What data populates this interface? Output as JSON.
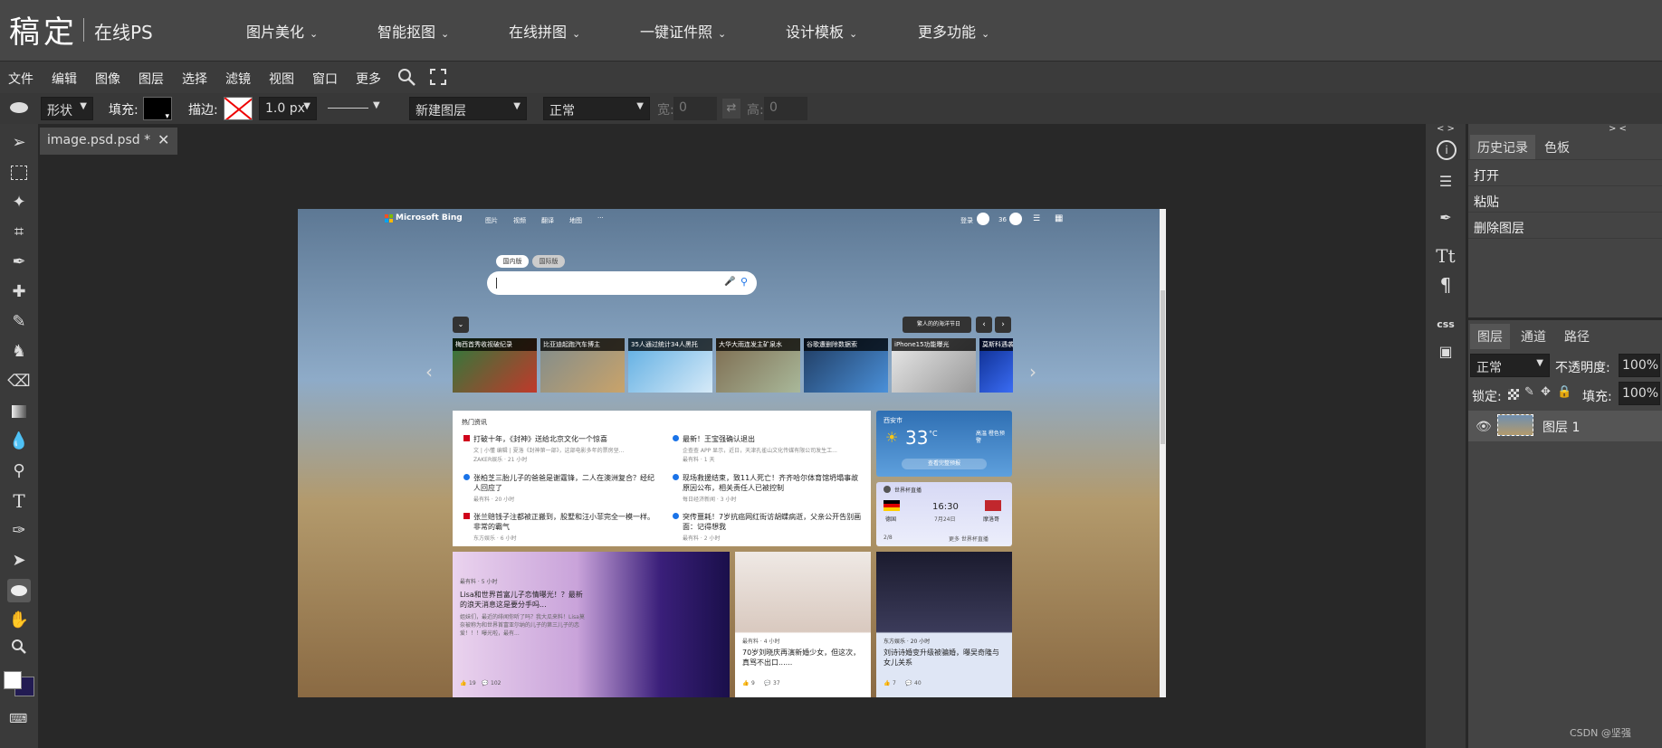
{
  "app": {
    "logo": "稿定",
    "logo_sub": "在线PS"
  },
  "topnav": [
    {
      "label": "图片美化"
    },
    {
      "label": "智能抠图"
    },
    {
      "label": "在线拼图"
    },
    {
      "label": "一键证件照"
    },
    {
      "label": "设计模板"
    },
    {
      "label": "更多功能"
    }
  ],
  "menubar": [
    "文件",
    "编辑",
    "图像",
    "图层",
    "选择",
    "滤镜",
    "视图",
    "窗口",
    "更多"
  ],
  "options": {
    "shape_mode": "形状",
    "fill_label": "填充:",
    "stroke_label": "描边:",
    "stroke_width": "1.0 px",
    "layer_mode": "新建图层",
    "blend_mode": "正常",
    "width_label": "宽:",
    "width_value": "0",
    "height_label": "高:",
    "height_value": "0",
    "fill_color": "#000000"
  },
  "document": {
    "tab_label": "image.psd.psd *"
  },
  "history_panel": {
    "tabs": [
      "历史记录",
      "色板"
    ],
    "items": [
      "打开",
      "粘贴",
      "删除图层"
    ]
  },
  "layers_panel": {
    "tabs": [
      "图层",
      "通道",
      "路径"
    ],
    "blend_mode": "正常",
    "opacity_label": "不透明度:",
    "opacity_value": "100%",
    "lock_label": "锁定:",
    "fill_label": "填充:",
    "fill_value": "100%",
    "layers": [
      {
        "name": "图层 1"
      }
    ]
  },
  "right_strip_collapse": "< >",
  "right_panel_collapse": "> <",
  "watermark": "CSDN @坚强",
  "canvas_page": {
    "brand": "Microsoft Bing",
    "nav": [
      "图片",
      "视频",
      "翻译",
      "地图",
      "···"
    ],
    "login": "登录",
    "points": "36",
    "search_tabs": [
      "国内版",
      "国际版"
    ],
    "location_chip": "繁人的的海洋节日",
    "thumbs": [
      "梅西首秀收视破纪录",
      "比亚迪起跑汽车博主",
      "35人通过统计34人黑托",
      "大华大雨连发主矿泉水",
      "谷歌遭删除数据索",
      "iPhone15功能曝光",
      "莫斯科遇袭"
    ],
    "hot_title": "热门资讯",
    "news": [
      {
        "title": "打破十年，《封神》送给北京文化一个惊喜",
        "snippet": "文 | 小懂 编辑 | 夏洛《封神第一部》，这部电影多年的票房坚...",
        "meta": "ZAKER娱乐 · 21 小时"
      },
      {
        "title": "最新！王宝强确认退出",
        "snippet": "企查查 APP 显示，近日，天津孔雀山文化传媒有限公司发生工...",
        "meta": "最有料 · 1 天"
      },
      {
        "title": "张柏芝三胎儿子的爸爸是谢霆锋，二人在澳洲复合？经纪人回应了",
        "snippet": "",
        "meta": "最有料 · 20 小时"
      },
      {
        "title": "现场救援结束，致11人死亡！齐齐哈尔体育馆坍塌事故原因公布，相关责任人已被控制",
        "snippet": "",
        "meta": "每日经济新闻 · 3 小时"
      },
      {
        "title": "张兰赔钱子注都被正搬到，股墅和汪小菲完全一模一样。非常的霸气",
        "snippet": "",
        "meta": "东方娱乐 · 6 小时"
      },
      {
        "title": "突传噩耗！7岁抗癌网红街访胡蝶病逝，父亲公开告别画面：记得想我",
        "snippet": "",
        "meta": "最有料 · 2 小时"
      }
    ],
    "weather": {
      "city": "西安市",
      "temp": "33",
      "unit": "°C",
      "link": "查看完整预报",
      "note": "高温 橙色预警"
    },
    "match": {
      "title": "世界杯直播",
      "team1": "德国",
      "team2": "摩洛哥",
      "time": "16:30",
      "date": "7月24日",
      "footer_left": "2/8",
      "footer_right": "更多 世界杯直播"
    },
    "story1": {
      "source": "最有料 · 5 小时",
      "title": "Lisa和世界首富儿子恋情曝光！？最新的浪天消息这是要分手吗...",
      "snippet": "姐妹们，最近的绯闻你听了吗？我大瓜来料！Lisa莫奈被称为和世界首富亚尔纳的儿子的第三儿子的恋爱！！！曝光啦，最有...",
      "likes": "19",
      "comments": "102"
    },
    "story2": {
      "source": "最有料 · 4 小时",
      "title": "70岁刘晓庆再演新婚少女，但这次，真骂不出口......",
      "likes": "9",
      "comments": "37"
    },
    "story3": {
      "source": "东方娱乐 · 20 小时",
      "title": "刘诗诗婚变升级被骗婚，曝吴奇隆与女儿关系",
      "likes": "7",
      "comments": "40"
    }
  }
}
